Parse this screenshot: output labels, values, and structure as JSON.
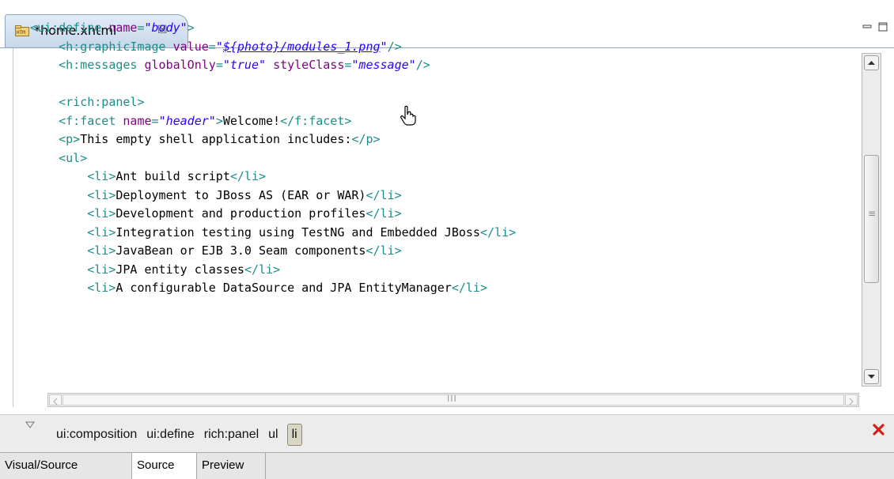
{
  "editor_tab": {
    "title": "*home.xhtml",
    "icon": "html-file-icon",
    "close_glyph": "☒"
  },
  "window_controls": {
    "minimize_icon": "minimize-icon",
    "maximize_icon": "maximize-icon"
  },
  "code_lines": [
    [
      {
        "c": "tag",
        "t": "<ui:define "
      },
      {
        "c": "attr",
        "t": "name"
      },
      {
        "c": "tag",
        "t": "="
      },
      {
        "c": "str",
        "t": "\"body\""
      },
      {
        "c": "tag",
        "t": ">"
      }
    ],
    [
      {
        "c": "txt",
        "t": "    "
      },
      {
        "c": "tag",
        "t": "<h:graphicImage "
      },
      {
        "c": "attr",
        "t": "value"
      },
      {
        "c": "tag",
        "t": "="
      },
      {
        "c": "str",
        "t": "\""
      },
      {
        "c": "link",
        "t": "${photo}/modules_1.png"
      },
      {
        "c": "str",
        "t": "\""
      },
      {
        "c": "tag",
        "t": "/>"
      }
    ],
    [
      {
        "c": "txt",
        "t": "    "
      },
      {
        "c": "tag",
        "t": "<h:messages "
      },
      {
        "c": "attr",
        "t": "globalOnly"
      },
      {
        "c": "tag",
        "t": "="
      },
      {
        "c": "str",
        "t": "\"true\""
      },
      {
        "c": "txt",
        "t": " "
      },
      {
        "c": "attr",
        "t": "styleClass"
      },
      {
        "c": "tag",
        "t": "="
      },
      {
        "c": "str",
        "t": "\"message\""
      },
      {
        "c": "tag",
        "t": "/>"
      }
    ],
    [
      {
        "c": "txt",
        "t": ""
      }
    ],
    [
      {
        "c": "txt",
        "t": "    "
      },
      {
        "c": "tag",
        "t": "<rich:panel>"
      }
    ],
    [
      {
        "c": "txt",
        "t": "    "
      },
      {
        "c": "tag",
        "t": "<f:facet "
      },
      {
        "c": "attr",
        "t": "name"
      },
      {
        "c": "tag",
        "t": "="
      },
      {
        "c": "str",
        "t": "\"header\""
      },
      {
        "c": "tag",
        "t": ">"
      },
      {
        "c": "txt",
        "t": "Welcome!"
      },
      {
        "c": "tag",
        "t": "</f:facet>"
      }
    ],
    [
      {
        "c": "txt",
        "t": "    "
      },
      {
        "c": "tag",
        "t": "<p>"
      },
      {
        "c": "txt",
        "t": "This empty shell application includes:"
      },
      {
        "c": "tag",
        "t": "</p>"
      }
    ],
    [
      {
        "c": "txt",
        "t": "    "
      },
      {
        "c": "tag",
        "t": "<ul>"
      }
    ],
    [
      {
        "c": "txt",
        "t": "        "
      },
      {
        "c": "tag",
        "t": "<li>"
      },
      {
        "c": "txt",
        "t": "Ant build script"
      },
      {
        "c": "tag",
        "t": "</li>"
      }
    ],
    [
      {
        "c": "txt",
        "t": "        "
      },
      {
        "c": "tag",
        "t": "<li>"
      },
      {
        "c": "txt",
        "t": "Deployment to JBoss AS (EAR or WAR)"
      },
      {
        "c": "tag",
        "t": "</li>"
      }
    ],
    [
      {
        "c": "txt",
        "t": "        "
      },
      {
        "c": "tag",
        "t": "<li>"
      },
      {
        "c": "txt",
        "t": "Development and production profiles"
      },
      {
        "c": "tag",
        "t": "</li>"
      }
    ],
    [
      {
        "c": "txt",
        "t": "        "
      },
      {
        "c": "tag",
        "t": "<li>"
      },
      {
        "c": "txt",
        "t": "Integration testing using TestNG and Embedded JBoss"
      },
      {
        "c": "tag",
        "t": "</li>"
      }
    ],
    [
      {
        "c": "txt",
        "t": "        "
      },
      {
        "c": "tag",
        "t": "<li>"
      },
      {
        "c": "txt",
        "t": "JavaBean or EJB 3.0 Seam components"
      },
      {
        "c": "tag",
        "t": "</li>"
      }
    ],
    [
      {
        "c": "txt",
        "t": "        "
      },
      {
        "c": "tag",
        "t": "<li>"
      },
      {
        "c": "txt",
        "t": "JPA entity classes"
      },
      {
        "c": "tag",
        "t": "</li>"
      }
    ],
    [
      {
        "c": "txt",
        "t": "        "
      },
      {
        "c": "tag",
        "t": "<li>"
      },
      {
        "c": "txt",
        "t": "A configurable DataSource and JPA EntityManager"
      },
      {
        "c": "tag",
        "t": "</li>"
      }
    ]
  ],
  "syntax_colors": {
    "tag": "#1d8d8a",
    "attribute": "#7f007f",
    "string": "#2a00ff",
    "text": "#000000"
  },
  "cursor_icon": "hand-pointer-icon",
  "selection_bar": {
    "toggle_icon": "collapse-triangle-icon",
    "crumbs": [
      {
        "label": "ui:composition",
        "selected": false
      },
      {
        "label": "ui:define",
        "selected": false
      },
      {
        "label": "rich:panel",
        "selected": false
      },
      {
        "label": "ul",
        "selected": false
      },
      {
        "label": "li",
        "selected": true
      }
    ],
    "close_icon": "red-x-icon",
    "close_color": "#d0201a"
  },
  "bottom_tabs": [
    {
      "label": "Visual/Source",
      "active": false
    },
    {
      "label": "Source",
      "active": true
    },
    {
      "label": "Preview",
      "active": false
    }
  ],
  "scrollbars": {
    "horizontal_grip": "III",
    "vertical_grip": "≡"
  }
}
